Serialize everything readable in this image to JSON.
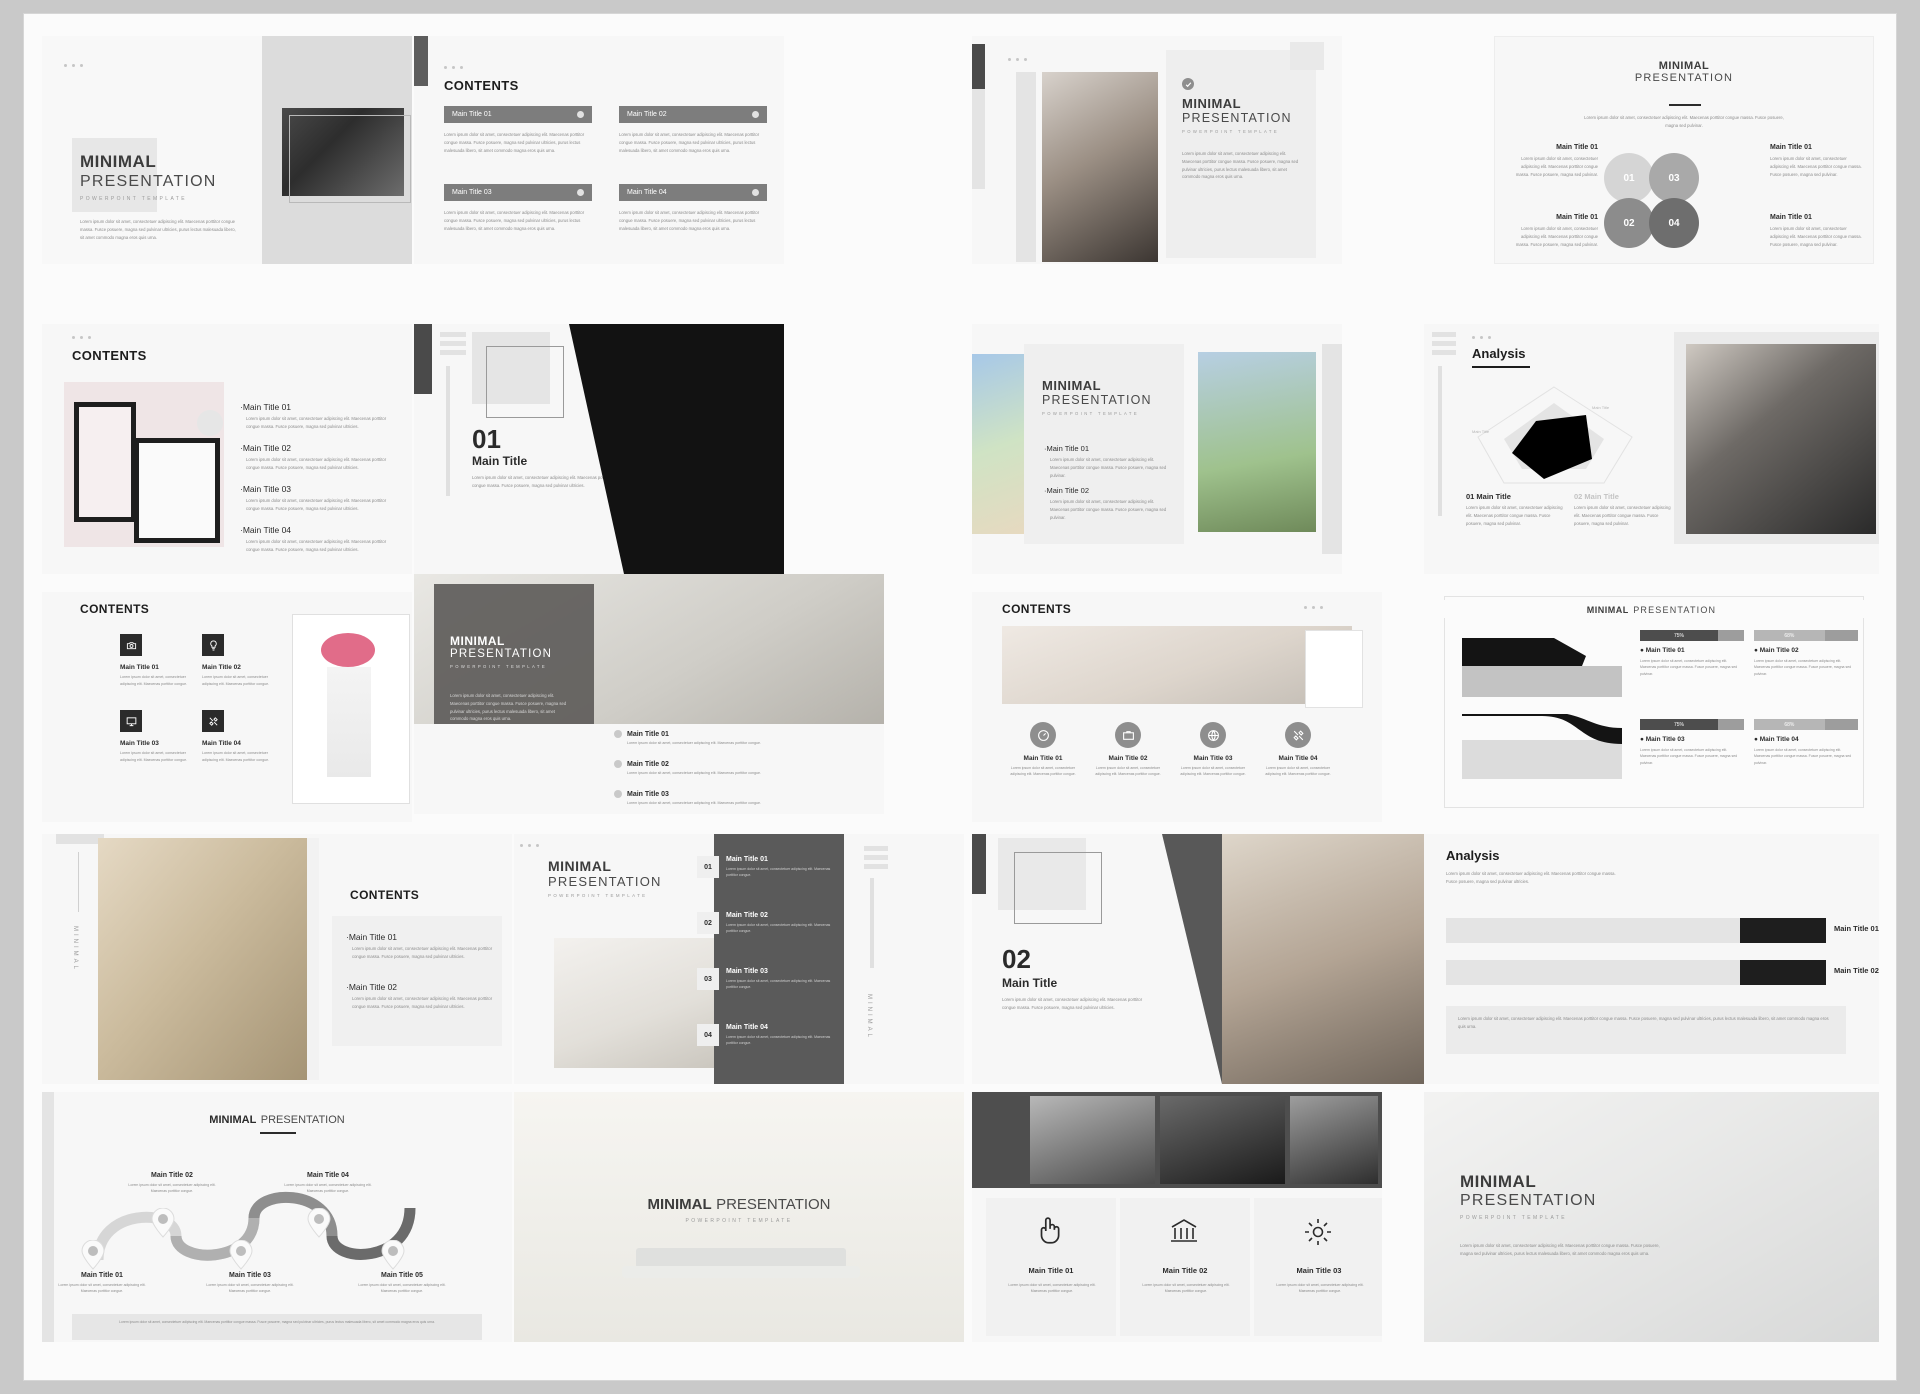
{
  "brand": {
    "word1": "MINIMAL",
    "word2": "PRESENTATION",
    "sub": "POWERPOINT TEMPLATE"
  },
  "lorem": {
    "full": "Lorem ipsum dolor sit amet, consectetuer adipiscing elit. Maecenas porttitor congue massa. Fusce posuere, magna sed pulvinar ultricies, purus lectus malesuada libero, sit amet commodo magna eros quis urna.",
    "mid": "Lorem ipsum dolor sit amet, consectetuer adipiscing elit. Maecenas porttitor congue massa. Fusce posuere, magna sed pulvinar ultricies.",
    "short": "Lorem ipsum dolor sit amet, consectetuer adipiscing elit. Maecenas porttitor congue massa. Fusce posuere, magna sed pulvinar.",
    "xshort": "Lorem ipsum dolor sit amet, consectetuer adipiscing elit. Maecenas porttitor congue."
  },
  "headings": {
    "contents": "CONTENTS",
    "analysis": "Analysis"
  },
  "titles": {
    "t1": "Main Title 01",
    "t2": "Main Title 02",
    "t3": "Main Title 03",
    "t4": "Main Title 04",
    "t5": "Main Title 05",
    "plain": "Main Title"
  },
  "numbers": {
    "n01": "01",
    "n02": "02",
    "n03": "03",
    "n04": "04"
  },
  "vertical_label": "MINIMAL",
  "slide_01_title": {
    "num": "01",
    "label": "Main Title"
  },
  "slide_02_title": {
    "num": "02",
    "label": "Main Title"
  },
  "analysis_legend": {
    "a": "01 Main Title",
    "b": "02 Main Title"
  },
  "percent_cards": [
    {
      "pct": "75%",
      "title": "Main Title 01"
    },
    {
      "pct": "68%",
      "title": "Main Title 02"
    },
    {
      "pct": "75%",
      "title": "Main Title 03"
    },
    {
      "pct": "68%",
      "title": "Main Title 04"
    }
  ],
  "colors": {
    "page": "#fbfbfb",
    "slide": "#f7f7f7",
    "bar": "#7d7d7d",
    "dark": "#2b2b2b",
    "mid": "#5d5d5d",
    "light": "#d9d9d9",
    "text": "#3c3c3c",
    "muted": "#8b8b8b"
  },
  "chart_data": {
    "type": "bar",
    "title": "MINIMAL PRESENTATION",
    "categories": [
      "Main Title 01",
      "Main Title 02",
      "Main Title 03",
      "Main Title 04"
    ],
    "values": [
      75,
      68,
      75,
      68
    ],
    "unit": "%",
    "ylim": [
      0,
      100
    ],
    "xlabel": "",
    "ylabel": "",
    "grid": false,
    "legend": "none"
  },
  "analysis_bars": {
    "type": "bar",
    "orientation": "horizontal",
    "categories": [
      "Main Title 01",
      "Main Title 02"
    ],
    "values": [
      78,
      72
    ],
    "ylim": [
      0,
      100
    ]
  },
  "icons": {
    "camera": "camera-icon",
    "bulb": "bulb-icon",
    "monitor": "monitor-icon",
    "tools": "tools-icon",
    "speed": "speedometer-icon",
    "briefcase": "briefcase-icon",
    "globe": "globe-icon",
    "hand": "hand-pointer-icon",
    "bank": "bank-icon",
    "gear": "gear-icon",
    "check": "check-circle-icon"
  }
}
